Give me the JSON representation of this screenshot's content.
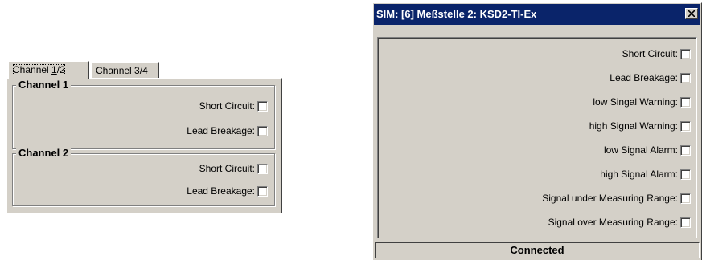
{
  "left_panel": {
    "tabs": [
      {
        "prefix": "Channel ",
        "accel": "1",
        "suffix": "/2"
      },
      {
        "prefix": "Channel ",
        "accel": "3",
        "suffix": "/4"
      }
    ],
    "groups": [
      {
        "title": "Channel 1",
        "items": [
          {
            "label": "Short Circuit:",
            "checked": false
          },
          {
            "label": "Lead Breakage:",
            "checked": false
          }
        ]
      },
      {
        "title": "Channel 2",
        "items": [
          {
            "label": "Short Circuit:",
            "checked": false
          },
          {
            "label": "Lead Breakage:",
            "checked": false
          }
        ]
      }
    ]
  },
  "sim_window": {
    "title": "SIM: [6] Meßstelle 2: KSD2-TI-Ex",
    "close_icon": "close-icon",
    "items": [
      {
        "label": "Short Circuit:",
        "checked": false
      },
      {
        "label": "Lead Breakage:",
        "checked": false
      },
      {
        "label": "low Singal Warning:",
        "checked": false
      },
      {
        "label": "high Signal Warning:",
        "checked": false
      },
      {
        "label": "low Signal Alarm:",
        "checked": false
      },
      {
        "label": "high Signal Alarm:",
        "checked": false
      },
      {
        "label": "Signal under Measuring Range:",
        "checked": false
      },
      {
        "label": "Signal over Measuring Range:",
        "checked": false
      }
    ],
    "status": "Connected"
  },
  "colors": {
    "titlebar": "#0a246a",
    "face": "#d4d0c8",
    "highlight": "#ffffff",
    "shadow": "#808080"
  }
}
